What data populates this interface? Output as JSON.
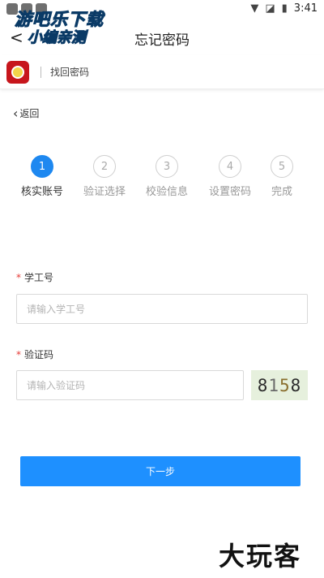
{
  "status_bar": {
    "time": "3:41"
  },
  "watermark": {
    "line1": "游吧乐下载",
    "line2": "小编亲测"
  },
  "header": {
    "title": "忘记密码"
  },
  "school_bar": {
    "subtitle": "找回密码"
  },
  "back_link": {
    "label": "返回"
  },
  "steps": [
    {
      "num": "1",
      "label": "核实账号",
      "active": true
    },
    {
      "num": "2",
      "label": "验证选择",
      "active": false
    },
    {
      "num": "3",
      "label": "校验信息",
      "active": false
    },
    {
      "num": "4",
      "label": "设置密码",
      "active": false
    },
    {
      "num": "5",
      "label": "完成",
      "active": false
    }
  ],
  "form": {
    "student_id": {
      "required_mark": "*",
      "label": "学工号",
      "value": "",
      "placeholder": "请输入学工号"
    },
    "captcha": {
      "required_mark": "*",
      "label": "验证码",
      "value": "",
      "placeholder": "请输入验证码",
      "image_text": [
        "8",
        "1",
        "5",
        "8"
      ]
    }
  },
  "next_button": {
    "label": "下一步"
  },
  "bottom_watermark": {
    "text": "大玩客"
  },
  "colors": {
    "primary": "#1e90ff",
    "required": "#e53935"
  }
}
